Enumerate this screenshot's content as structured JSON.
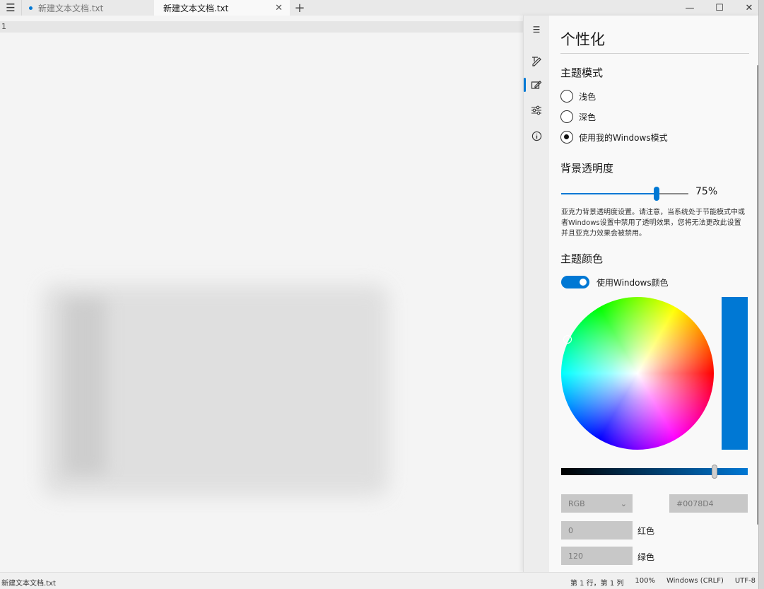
{
  "titlebar": {
    "tabs": [
      {
        "label": "新建文本文档.txt",
        "unsaved": true
      },
      {
        "label": "新建文本文档.txt",
        "active": true
      }
    ],
    "menu_icon": "☰",
    "close_tab_icon": "✕",
    "new_tab_icon": "+",
    "minimize_icon": "—",
    "maximize_icon": "☐",
    "close_icon": "✕"
  },
  "editor": {
    "line_number": "1"
  },
  "panel": {
    "title": "个性化",
    "nav": {
      "menu_icon": "☰",
      "text_icon": "✎",
      "personalize_icon": "🖌",
      "settings_icon": "☷",
      "about_icon": "ⓘ"
    },
    "theme_mode": {
      "heading": "主题模式",
      "options": [
        {
          "label": "浅色",
          "checked": false
        },
        {
          "label": "深色",
          "checked": false
        },
        {
          "label": "使用我的Windows模式",
          "checked": true
        }
      ]
    },
    "transparency": {
      "heading": "背景透明度",
      "value": 75,
      "value_label": "75%",
      "description": "亚克力背景透明度设置。请注意，当系统处于节能模式中或者Windows设置中禁用了透明效果，您将无法更改此设置并且亚克力效果会被禁用。"
    },
    "theme_color": {
      "heading": "主题颜色",
      "toggle_label": "使用Windows颜色",
      "toggle_on": true,
      "selected_color": "#0078d4",
      "color_model": "RGB",
      "hex_value": "#0078D4",
      "red_value": "0",
      "red_label": "红色",
      "green_value": "120",
      "green_label": "绿色",
      "dropdown_icon": "⌄"
    }
  },
  "statusbar": {
    "file_name": "新建文本文档.txt",
    "position": "第 1 行，第 1 列",
    "zoom": "100%",
    "line_ending": "Windows (CRLF)",
    "encoding": "UTF-8"
  }
}
